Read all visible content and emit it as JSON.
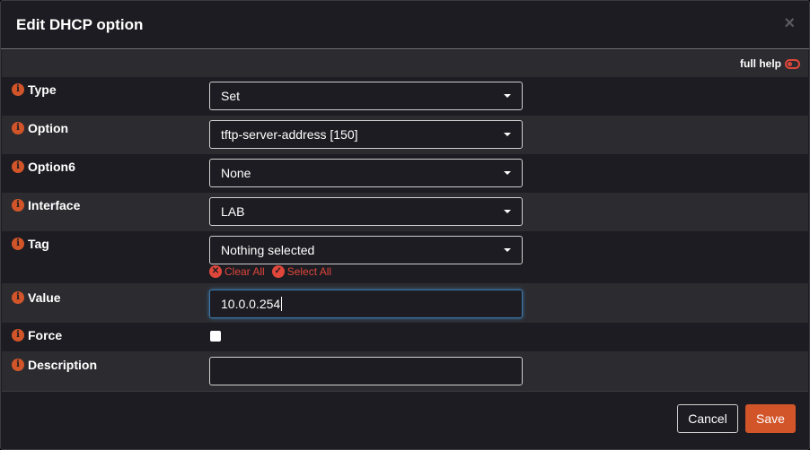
{
  "dialog": {
    "title": "Edit DHCP option",
    "close_glyph": "×"
  },
  "help": {
    "label": "full help"
  },
  "fields": {
    "type": {
      "label": "Type",
      "value": "Set"
    },
    "option": {
      "label": "Option",
      "value": "tftp-server-address [150]"
    },
    "option6": {
      "label": "Option6",
      "value": "None"
    },
    "interface": {
      "label": "Interface",
      "value": "LAB"
    },
    "tag": {
      "label": "Tag",
      "value": "Nothing selected",
      "clear_all": "Clear All",
      "select_all": "Select All"
    },
    "value": {
      "label": "Value",
      "value": "10.0.0.254"
    },
    "force": {
      "label": "Force",
      "checked": false
    },
    "description": {
      "label": "Description",
      "value": ""
    }
  },
  "info_glyph": "i",
  "buttons": {
    "cancel": "Cancel",
    "save": "Save"
  },
  "colors": {
    "accent": "#d2552a",
    "danger": "#e0473b",
    "background": "#1c1c22",
    "row_alt": "#2c2c30",
    "focus": "#3c77a8"
  }
}
